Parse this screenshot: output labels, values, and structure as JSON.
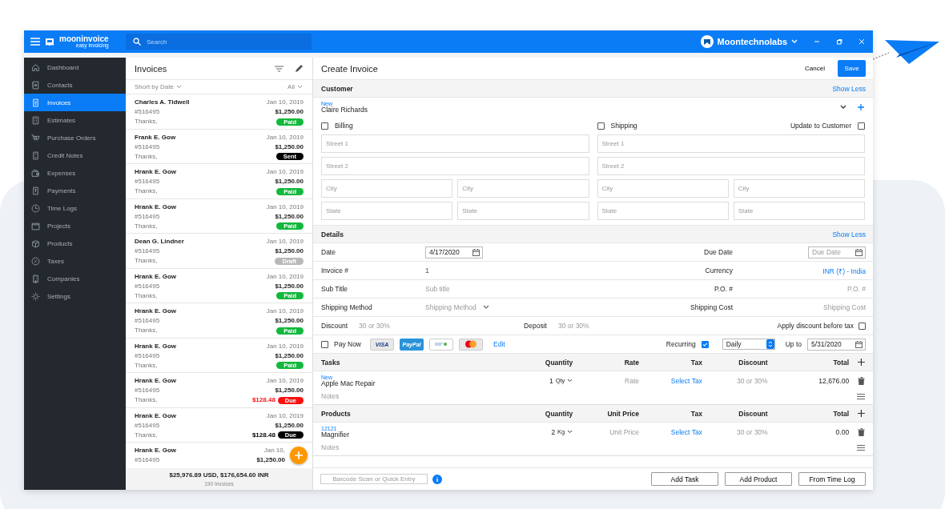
{
  "app": {
    "brand": "mooninvoice",
    "tagline": "easy invoicing",
    "search": {
      "placeholder": "Search"
    },
    "account": "Moontechnolabs"
  },
  "sidebar": {
    "items": [
      {
        "label": "Dashboard",
        "selected": false
      },
      {
        "label": "Contacts",
        "selected": false
      },
      {
        "label": "Invoices",
        "selected": true
      },
      {
        "label": "Estimates",
        "selected": false
      },
      {
        "label": "Purchase Orders",
        "selected": false
      },
      {
        "label": "Credit Notes",
        "selected": false
      },
      {
        "label": "Expenses",
        "selected": false
      },
      {
        "label": "Payments",
        "selected": false
      },
      {
        "label": "Time Logs",
        "selected": false
      },
      {
        "label": "Projects",
        "selected": false
      },
      {
        "label": "Products",
        "selected": false
      },
      {
        "label": "Taxes",
        "selected": false
      },
      {
        "label": "Companies",
        "selected": false
      },
      {
        "label": "Settings",
        "selected": false
      }
    ]
  },
  "invoice_list": {
    "title": "Invoices",
    "sort": "Short by Date",
    "filter": "All",
    "invoices": [
      {
        "name": "Charles A. Tidwell",
        "date": "Jan 10, 2019",
        "number": "#516495",
        "amount": "$1,250.00",
        "note": "Thanks,",
        "status": {
          "label": "Paid",
          "color": "#12b83c"
        }
      },
      {
        "name": "Frank E. Gow",
        "date": "Jan 10, 2019",
        "number": "#516495",
        "amount": "$1,250.00",
        "note": "Thanks,",
        "status": {
          "label": "Sent",
          "color": "#000000"
        }
      },
      {
        "name": "Hrank E. Gow",
        "date": "Jan 10, 2019",
        "number": "#516495",
        "amount": "$1,250.00",
        "note": "Thanks,",
        "status": {
          "label": "Paid",
          "color": "#12b83c"
        }
      },
      {
        "name": "Hrank E. Gow",
        "date": "Jan 10, 2019",
        "number": "#516495",
        "amount": "$1,250.00",
        "note": "Thanks,",
        "status": {
          "label": "Paid",
          "color": "#12b83c"
        }
      },
      {
        "name": "Dean G. Lindner",
        "date": "Jan 10, 2019",
        "number": "#516495",
        "amount": "$1,250.00",
        "note": "Thanks,",
        "status": {
          "label": "Draft",
          "color": "#b9b9b9"
        }
      },
      {
        "name": "Hrank E. Gow",
        "date": "Jan 10, 2019",
        "number": "#516495",
        "amount": "$1,250.00",
        "note": "Thanks,",
        "status": {
          "label": "Paid",
          "color": "#12b83c"
        }
      },
      {
        "name": "Hrank E. Gow",
        "date": "Jan 10, 2019",
        "number": "#516495",
        "amount": "$1,250.00",
        "note": "Thanks,",
        "status": {
          "label": "Paid",
          "color": "#12b83c"
        }
      },
      {
        "name": "Hrank E. Gow",
        "date": "Jan 10, 2019",
        "number": "#516495",
        "amount": "$1,250.00",
        "note": "Thanks,",
        "status": {
          "label": "Paid",
          "color": "#12b83c"
        }
      },
      {
        "name": "Hrank E. Gow",
        "date": "Jan 10, 2019",
        "number": "#516495",
        "amount": "$1,250.00",
        "note": "Thanks,",
        "due": "$128.48",
        "status": {
          "label": "Due",
          "color": "#fa0f0f"
        }
      },
      {
        "name": "Hrank E. Gow",
        "date": "Jan 10, 2019",
        "number": "#516495",
        "amount": "$1,250.00",
        "note": "Thanks,",
        "due": "$128.48",
        "status": {
          "label": "Due",
          "color": "#000000"
        }
      },
      {
        "name": "Hrank E. Gow",
        "date": "Jan 10,",
        "number": "#516495",
        "amount": "$1,250.00"
      }
    ],
    "totals": "$25,976.89 USD, $176,654.60 INR",
    "count": "190 Invoices"
  },
  "form": {
    "title": "Create Invoice",
    "cancel": "Cancel",
    "save": "Save",
    "customer": {
      "title": "Customer",
      "toggle": "Show Less",
      "tag": "New",
      "name": "Claire Richards",
      "billing": {
        "label": "Billing",
        "checked": false
      },
      "shipping": {
        "label": "Shipping",
        "checked": false
      },
      "update": {
        "label": "Update to Customer",
        "checked": false
      },
      "billing_fields": [
        {
          "placeholder": "Street 1"
        },
        {
          "placeholder": "Street 2"
        },
        {
          "placeholder": "City"
        },
        {
          "placeholder": "City"
        },
        {
          "placeholder": "State"
        },
        {
          "placeholder": "State"
        }
      ],
      "shipping_fields": [
        {
          "placeholder": "Street 1"
        },
        {
          "placeholder": "Street 2"
        },
        {
          "placeholder": "City"
        },
        {
          "placeholder": "City"
        },
        {
          "placeholder": "State"
        },
        {
          "placeholder": "State"
        }
      ]
    },
    "details": {
      "title": "Details",
      "toggle": "Show Less",
      "rows": [
        {
          "left": {
            "label": "Date",
            "kind": "date",
            "value": "4/17/2020"
          },
          "right": {
            "label": "Due Date",
            "kind": "date",
            "placeholder": "Due Date"
          }
        },
        {
          "left": {
            "label": "Invoice #",
            "kind": "text",
            "value": "1"
          },
          "right": {
            "label": "Currency",
            "kind": "link",
            "value": "INR (₹) - India"
          }
        },
        {
          "left": {
            "label": "Sub Title",
            "kind": "text",
            "placeholder": "Sub title"
          },
          "right": {
            "label": "P.O. #",
            "kind": "text",
            "placeholder": "P.O. #"
          }
        },
        {
          "left": {
            "label": "Shipping Method",
            "kind": "select",
            "placeholder": "Shipping Method"
          },
          "right": {
            "label": "Shipping Cost",
            "kind": "text",
            "placeholder": "Shipping Cost"
          }
        }
      ],
      "discount": {
        "label": "Discount",
        "placeholder": "30 or 30%"
      },
      "deposit": {
        "label": "Deposit",
        "placeholder": "30 or 30%"
      },
      "apply_before_tax": {
        "label": "Apply discount before tax",
        "checked": false
      }
    },
    "payment": {
      "pay_now": {
        "label": "Pay Now",
        "checked": false
      },
      "methods": [
        {
          "kind": "visa",
          "label": "VISA"
        },
        {
          "kind": "paypal",
          "label": "PayPal"
        },
        {
          "kind": "bank"
        },
        {
          "kind": "mastercard"
        }
      ],
      "edit": "Edit",
      "recurring": {
        "label": "Recurring",
        "checked": true
      },
      "frequency": "Daily",
      "up_to": "Up to",
      "end_date": "5/31/2020"
    },
    "tasks": {
      "columns": [
        "Tasks",
        "Quantity",
        "Rate",
        "Tax",
        "Discount",
        "Total"
      ],
      "rows": [
        {
          "tag": "New",
          "name": "Apple Mac Repair",
          "quantity": "1",
          "unit": "Qty",
          "price": "Rate",
          "tax": "Select Tax",
          "discount": "30 or 30%",
          "total": "12,676.00",
          "notes": "Notes"
        }
      ]
    },
    "products": {
      "columns": [
        "Products",
        "Quantity",
        "Unit Price",
        "Tax",
        "Discount",
        "Total"
      ],
      "rows": [
        {
          "tag": "12121",
          "name": "Magnifier",
          "quantity": "2",
          "unit": "Kg",
          "price": "Unit Price",
          "tax": "Select Tax",
          "discount": "30 or 30%",
          "total": "0.00",
          "notes": "Notes"
        }
      ]
    },
    "footer": {
      "barcode": {
        "placeholder": "Barcode Scan or Quick Entry"
      },
      "buttons": [
        "Add Task",
        "Add Product",
        "From Time Log"
      ]
    }
  }
}
